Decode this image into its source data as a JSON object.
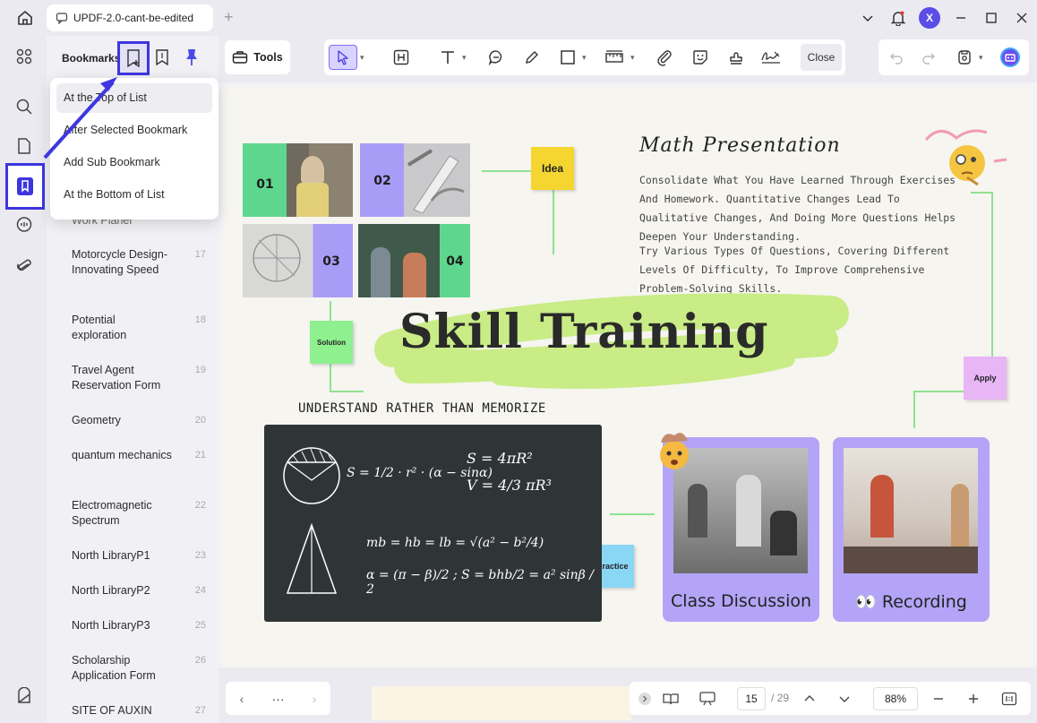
{
  "titlebar": {
    "tab_title": "UPDF-2.0-cant-be-edited",
    "new_tab": "+",
    "avatar_initial": "X"
  },
  "panel": {
    "title": "Bookmarks",
    "dropdown": [
      "At the Top of List",
      "After Selected Bookmark",
      "Add Sub Bookmark",
      "At the Bottom of List"
    ],
    "bookmarks": [
      {
        "label": "Work Planer",
        "num": ""
      },
      {
        "label": "Motorcycle Design-Innovating Speed",
        "num": "17"
      },
      {
        "label": "Potential exploration",
        "num": "18"
      },
      {
        "label": "Travel Agent Reservation Form",
        "num": "19"
      },
      {
        "label": "Geometry",
        "num": "20"
      },
      {
        "label": "quantum mechanics",
        "num": "21"
      },
      {
        "label": "Electromagnetic Spectrum",
        "num": "22"
      },
      {
        "label": "North LibraryP1",
        "num": "23"
      },
      {
        "label": "North LibraryP2",
        "num": "24"
      },
      {
        "label": "North LibraryP3",
        "num": "25"
      },
      {
        "label": "Scholarship Application Form",
        "num": "26"
      },
      {
        "label": "SITE OF AUXIN",
        "num": "27"
      }
    ]
  },
  "toolbar": {
    "tools_label": "Tools",
    "close_label": "Close"
  },
  "page": {
    "tags": [
      "01",
      "02",
      "03",
      "04"
    ],
    "idea": "Idea",
    "solution": "Solution",
    "apply": "Apply",
    "practice": "Practice",
    "math_title": "Math Presentation",
    "para1": "Consolidate What You Have Learned Through Exercises And Homework. Quantitative Changes Lead To Qualitative Changes, And Doing More Questions Helps Deepen Your Understanding.",
    "para2": "Try Various Types Of Questions, Covering Different Levels Of Difficulty, To Improve Comprehensive Problem-Solving Skills.",
    "skill_title": "Skill Training",
    "subtitle": "UNDERSTAND RATHER THAN MEMORIZE",
    "card1": "Class Discussion",
    "card2": "Recording",
    "formulas": {
      "f1": "S = 1/2 · r² · (α − sinα)",
      "f2": "S = 4πR²",
      "f3": "V = 4/3 πR³",
      "f4": "mb = hb = lb = √(a² − b²/4)",
      "f5": "α = (π − β)/2 ; S = bhb/2 = a² sinβ / 2"
    }
  },
  "footer": {
    "prev": "‹",
    "more": "···",
    "next": "›",
    "page_current": "15",
    "page_total": "/ 29",
    "zoom": "88%"
  },
  "colors": {
    "accent": "#3d36e0",
    "green": "#5fd68e",
    "purple": "#a89cf7",
    "yellow_sticky": "#f5d530",
    "board": "#2f3437"
  }
}
